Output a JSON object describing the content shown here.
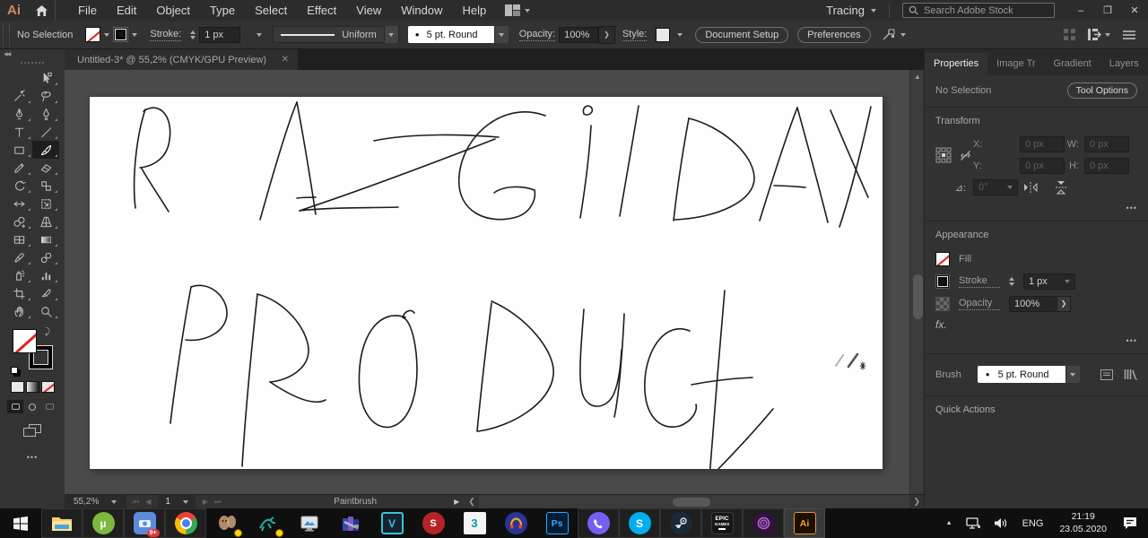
{
  "icons": {
    "minimize": "–",
    "restore": "❐",
    "close": "✕",
    "tab_close": "✕",
    "more": "•••",
    "collapse_left": "◀◀",
    "up": "▲",
    "down": "▼",
    "nav_first": "⏮",
    "nav_prev": "◀",
    "nav_next": "▶",
    "nav_last": "⏭",
    "play": "▶",
    "left_small": "❮",
    "right_small": "❯",
    "swap": "⤸",
    "caret_up": "▲"
  },
  "menubar": {
    "logo": "Ai",
    "items": [
      "File",
      "Edit",
      "Object",
      "Type",
      "Select",
      "Effect",
      "View",
      "Window",
      "Help"
    ],
    "tracing": "Tracing",
    "search_placeholder": "Search Adobe Stock"
  },
  "controlbar": {
    "no_selection": "No Selection",
    "stroke_label": "Stroke:",
    "stroke_value": "1 px",
    "profile_value": "Uniform",
    "brush_dot": "●",
    "brush_value": "5 pt. Round",
    "opacity_label": "Opacity:",
    "opacity_value": "100%",
    "more_arrow": "❯",
    "style_label": "Style:",
    "doc_setup": "Document Setup",
    "preferences": "Preferences"
  },
  "tab": {
    "title": "Untitled-3* @ 55,2% (CMYK/GPU Preview)"
  },
  "artwork": {
    "word1": "RAZGILDAY",
    "word2": "PRODUCT"
  },
  "panel": {
    "tabs": [
      "Properties",
      "Image Tr",
      "Gradient",
      "Layers"
    ],
    "no_selection": "No Selection",
    "tool_options": "Tool Options",
    "transform": {
      "title": "Transform",
      "x": "X:",
      "y": "Y:",
      "w": "W:",
      "h": "H:",
      "xv": "0 px",
      "yv": "0 px",
      "wv": "0 px",
      "hv": "0 px",
      "angle_label": "⊿:",
      "anglev": "0°"
    },
    "appearance": {
      "title": "Appearance",
      "fill": "Fill",
      "stroke": "Stroke",
      "strokev": "1 px",
      "opacity": "Opacity",
      "opacityv": "100%",
      "fx": "fx."
    },
    "brush": {
      "label": "Brush",
      "dot": "●",
      "value": "5 pt. Round"
    },
    "quick": "Quick Actions"
  },
  "status": {
    "zoom": "55,2%",
    "artboard": "1",
    "tool": "Paintbrush"
  },
  "taskbar": {
    "labels": {
      "utorrent": "µ",
      "gplus_badge": "9+",
      "vegas": "V",
      "max": "3",
      "ps": "Ps",
      "sai": "S",
      "skype": "S",
      "epic1": "EPIC",
      "epic2": "GAMES",
      "ai": "Ai"
    },
    "tray": {
      "lang": "ENG",
      "time": "21:19",
      "date": "23.05.2020"
    }
  }
}
